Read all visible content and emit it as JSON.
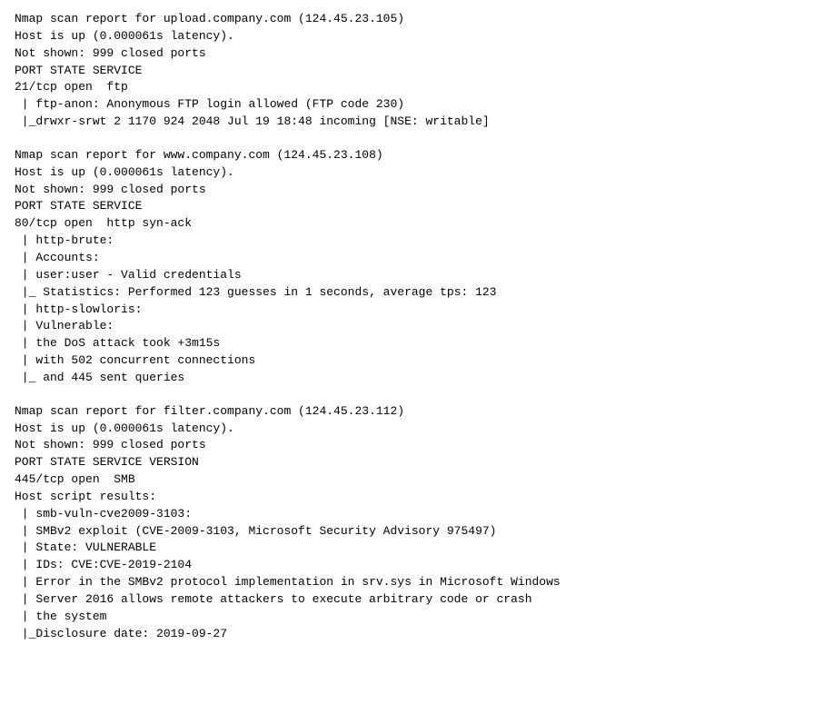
{
  "sections": [
    {
      "id": "section-1",
      "lines": [
        "Nmap scan report for upload.company.com (124.45.23.105)",
        "Host is up (0.000061s latency).",
        "Not shown: 999 closed ports",
        "PORT STATE SERVICE",
        "21/tcp open  ftp",
        " | ftp-anon: Anonymous FTP login allowed (FTP code 230)",
        " |_drwxr-srwt 2 1170 924 2048 Jul 19 18:48 incoming [NSE: writable]"
      ]
    },
    {
      "id": "section-2",
      "lines": [
        "Nmap scan report for www.company.com (124.45.23.108)",
        "Host is up (0.000061s latency).",
        "Not shown: 999 closed ports",
        "PORT STATE SERVICE",
        "80/tcp open  http syn-ack",
        " | http-brute:",
        " | Accounts:",
        " | user:user - Valid credentials",
        " |_ Statistics: Performed 123 guesses in 1 seconds, average tps: 123",
        " | http-slowloris:",
        " | Vulnerable:",
        " | the DoS attack took +3m15s",
        " | with 502 concurrent connections",
        " |_ and 445 sent queries"
      ]
    },
    {
      "id": "section-3",
      "lines": [
        "Nmap scan report for filter.company.com (124.45.23.112)",
        "Host is up (0.000061s latency).",
        "Not shown: 999 closed ports",
        "PORT STATE SERVICE VERSION",
        "445/tcp open  SMB",
        "Host script results:",
        " | smb-vuln-cve2009-3103:",
        " | SMBv2 exploit (CVE-2009-3103, Microsoft Security Advisory 975497)",
        " | State: VULNERABLE",
        " | IDs: CVE:CVE-2019-2104",
        " | Error in the SMBv2 protocol implementation in srv.sys in Microsoft Windows",
        " | Server 2016 allows remote attackers to execute arbitrary code or crash",
        " | the system",
        " |_Disclosure date: 2019-09-27"
      ]
    }
  ]
}
